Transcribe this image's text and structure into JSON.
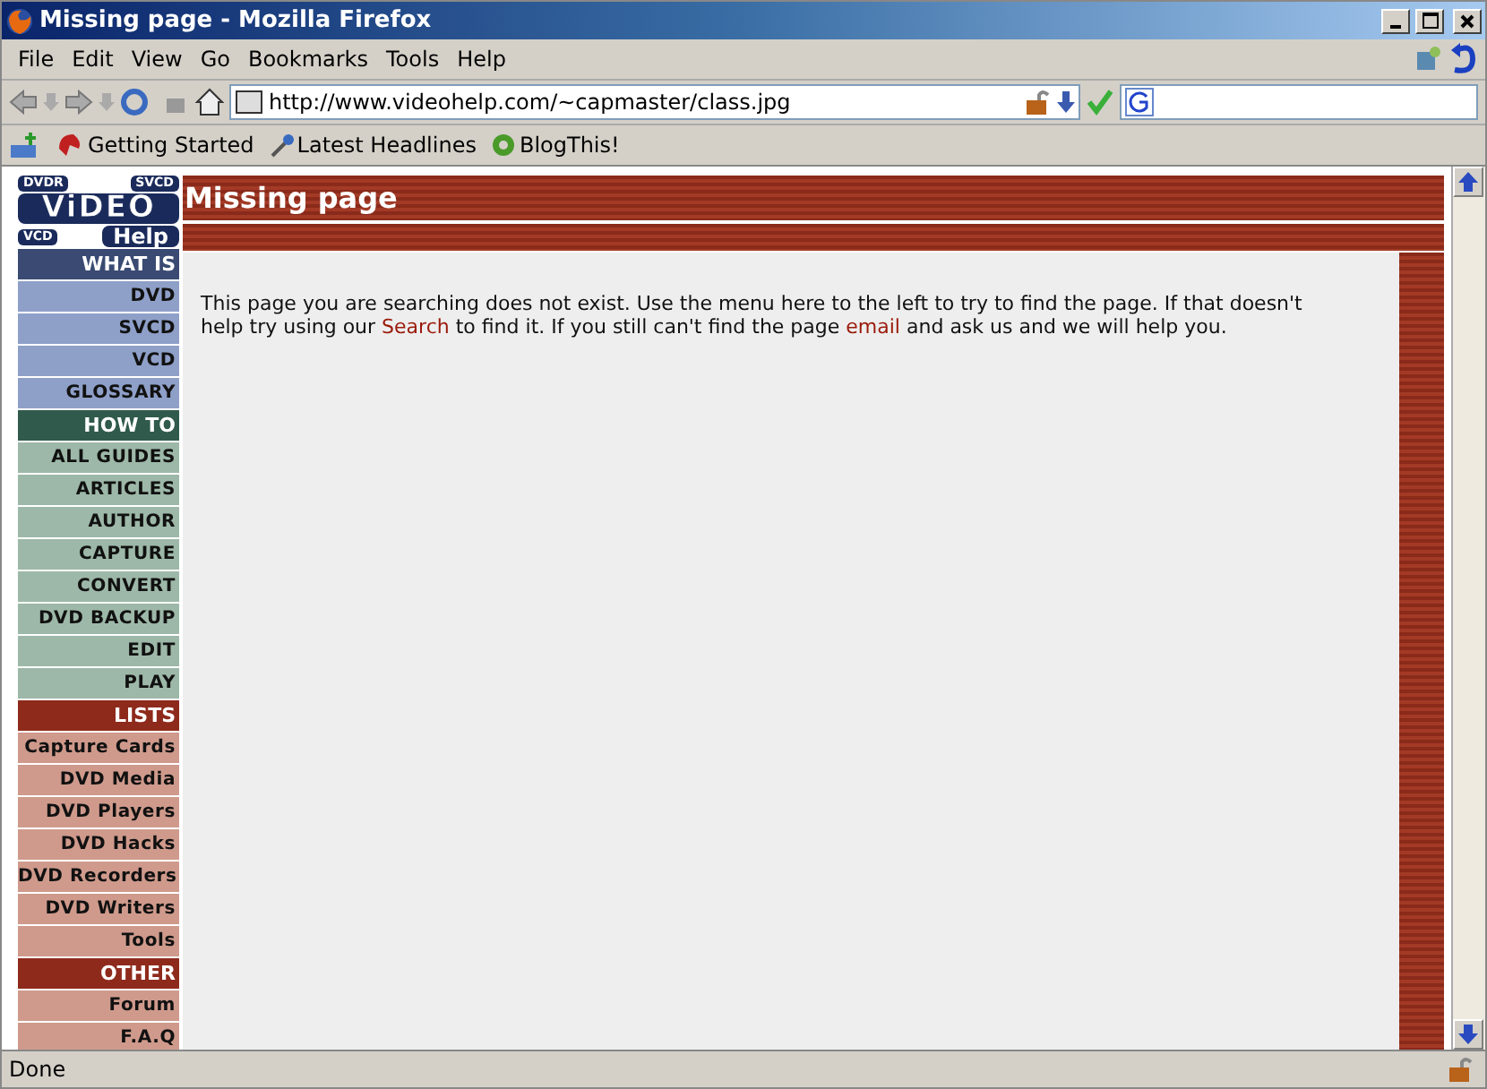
{
  "window": {
    "title": "Missing page - Mozilla Firefox"
  },
  "menu": [
    "File",
    "Edit",
    "View",
    "Go",
    "Bookmarks",
    "Tools",
    "Help"
  ],
  "address": {
    "value": "http://www.videohelp.com/~capmaster/class.jpg"
  },
  "bookmarks": [
    "Getting Started",
    "Latest Headlines",
    "BlogThis!"
  ],
  "page": {
    "logo": {
      "top_left": "DVDR",
      "top_right": "SVCD",
      "main": "ViDEO",
      "bottom_left": "VCD",
      "bottom_right": "Help"
    },
    "heading": "Missing page",
    "sidebar": [
      {
        "title": "WHAT IS",
        "color": "#3a4a72",
        "items": [
          {
            "label": "DVD",
            "color": "#8e9fc8"
          },
          {
            "label": "SVCD",
            "color": "#8e9fc8"
          },
          {
            "label": "VCD",
            "color": "#8e9fc8"
          },
          {
            "label": "GLOSSARY",
            "color": "#8e9fc8"
          }
        ]
      },
      {
        "title": "HOW TO",
        "color": "#2f5a4c",
        "items": [
          {
            "label": "ALL GUIDES",
            "color": "#9db8a8"
          },
          {
            "label": "ARTICLES",
            "color": "#9db8a8"
          },
          {
            "label": "AUTHOR",
            "color": "#9db8a8"
          },
          {
            "label": "CAPTURE",
            "color": "#9db8a8"
          },
          {
            "label": "CONVERT",
            "color": "#9db8a8"
          },
          {
            "label": "DVD BACKUP",
            "color": "#9db8a8"
          },
          {
            "label": "EDIT",
            "color": "#9db8a8"
          },
          {
            "label": "PLAY",
            "color": "#9db8a8"
          }
        ]
      },
      {
        "title": "LISTS",
        "color": "#8e2a1c",
        "items": [
          {
            "label": "Capture Cards",
            "color": "#cf9a8c"
          },
          {
            "label": "DVD Media",
            "color": "#cf9a8c"
          },
          {
            "label": "DVD Players",
            "color": "#cf9a8c"
          },
          {
            "label": "DVD Hacks",
            "color": "#cf9a8c"
          },
          {
            "label": "DVD Recorders",
            "color": "#cf9a8c"
          },
          {
            "label": "DVD Writers",
            "color": "#cf9a8c"
          },
          {
            "label": "Tools",
            "color": "#cf9a8c"
          }
        ]
      },
      {
        "title": "OTHER",
        "color": "#8e2a1c",
        "items": [
          {
            "label": "Forum",
            "color": "#cf9a8c"
          },
          {
            "label": "F.A.Q",
            "color": "#cf9a8c"
          }
        ]
      }
    ],
    "message": [
      {
        "kind": "text",
        "text": "This page you are searching does not exist. Use the menu here to the left to try to find the page. If that doesn't help try using our "
      },
      {
        "kind": "link",
        "text": "Search"
      },
      {
        "kind": "text",
        "text": " to find it. If you still can't find the page "
      },
      {
        "kind": "link",
        "text": "email"
      },
      {
        "kind": "text",
        "text": " and ask us and we will help you."
      }
    ]
  },
  "status_bar": {
    "text": "Done"
  }
}
